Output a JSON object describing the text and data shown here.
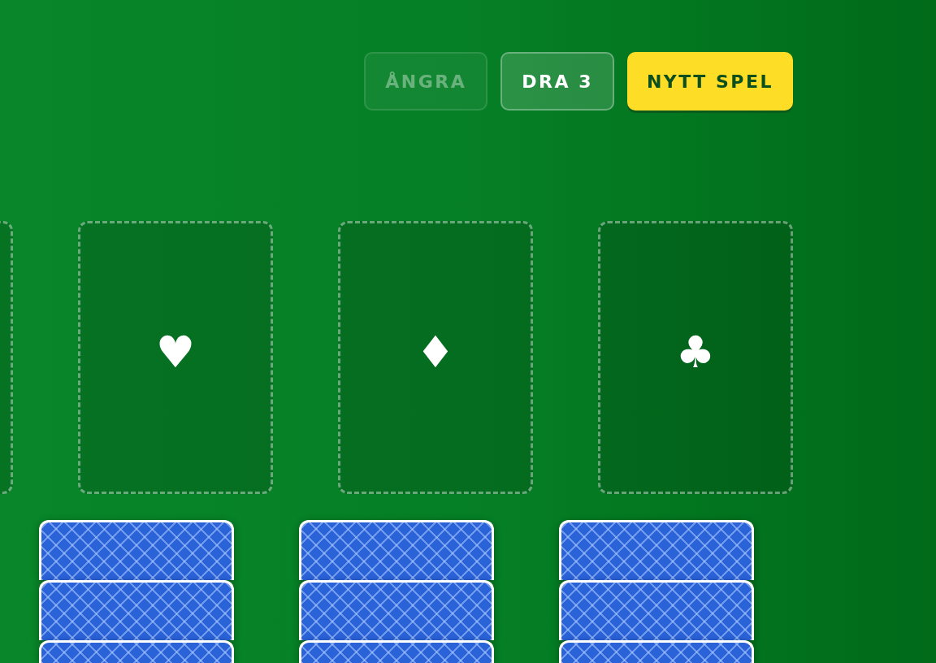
{
  "toolbar": {
    "buttons": [
      {
        "label": "ÅNGRA",
        "kind": "secondary",
        "disabled": true
      },
      {
        "label": "DRA 3",
        "kind": "secondary",
        "disabled": false
      },
      {
        "label": "NYTT SPEL",
        "kind": "primary",
        "disabled": false
      }
    ]
  },
  "foundations": [
    {
      "empty": true
    },
    {
      "empty": true,
      "symbol": "♥"
    },
    {
      "empty": true,
      "symbol": "♦"
    },
    {
      "empty": true,
      "symbol": "♣"
    }
  ],
  "tableau": [
    {
      "cards": [
        {
          "face_up": false
        },
        {
          "face_up": false
        },
        {
          "face_up": false
        }
      ]
    },
    {
      "cards": [
        {
          "face_up": false
        },
        {
          "face_up": false
        },
        {
          "face_up": false
        }
      ]
    },
    {
      "cards": [
        {
          "face_up": false
        },
        {
          "face_up": false
        },
        {
          "face_up": false
        }
      ]
    }
  ]
}
